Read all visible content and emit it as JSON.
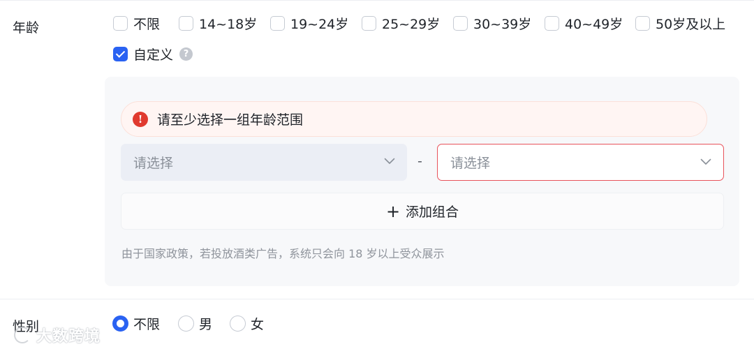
{
  "age": {
    "label": "年龄",
    "options": [
      {
        "label": "不限",
        "checked": false
      },
      {
        "label": "14~18岁",
        "checked": false
      },
      {
        "label": "19~24岁",
        "checked": false
      },
      {
        "label": "25~29岁",
        "checked": false
      },
      {
        "label": "30~39岁",
        "checked": false
      },
      {
        "label": "40~49岁",
        "checked": false
      },
      {
        "label": "50岁及以上",
        "checked": false
      }
    ],
    "custom": {
      "label": "自定义",
      "checked": true,
      "help_icon": "question-circle-icon"
    },
    "error": {
      "icon": "exclamation-circle-icon",
      "text": "请至少选择一组年龄范围",
      "color": "#e03a2f"
    },
    "range": {
      "from_placeholder": "请选择",
      "separator": "-",
      "to_placeholder": "请选择",
      "chevron_icon": "chevron-down-icon"
    },
    "add_combo": {
      "icon": "plus-icon",
      "label": "添加组合"
    },
    "notice": "由于国家政策，若投放酒类广告，系统只会向 18 岁以上受众展示"
  },
  "gender": {
    "label": "性别",
    "options": [
      {
        "label": "不限",
        "selected": true
      },
      {
        "label": "男",
        "selected": false
      },
      {
        "label": "女",
        "selected": false
      }
    ]
  },
  "watermark": {
    "text": "大数跨境"
  },
  "colors": {
    "accent": "#2a62f2",
    "error": "#e03a2f",
    "error_border": "#e8525b",
    "panel_bg": "#f7f8fa"
  }
}
